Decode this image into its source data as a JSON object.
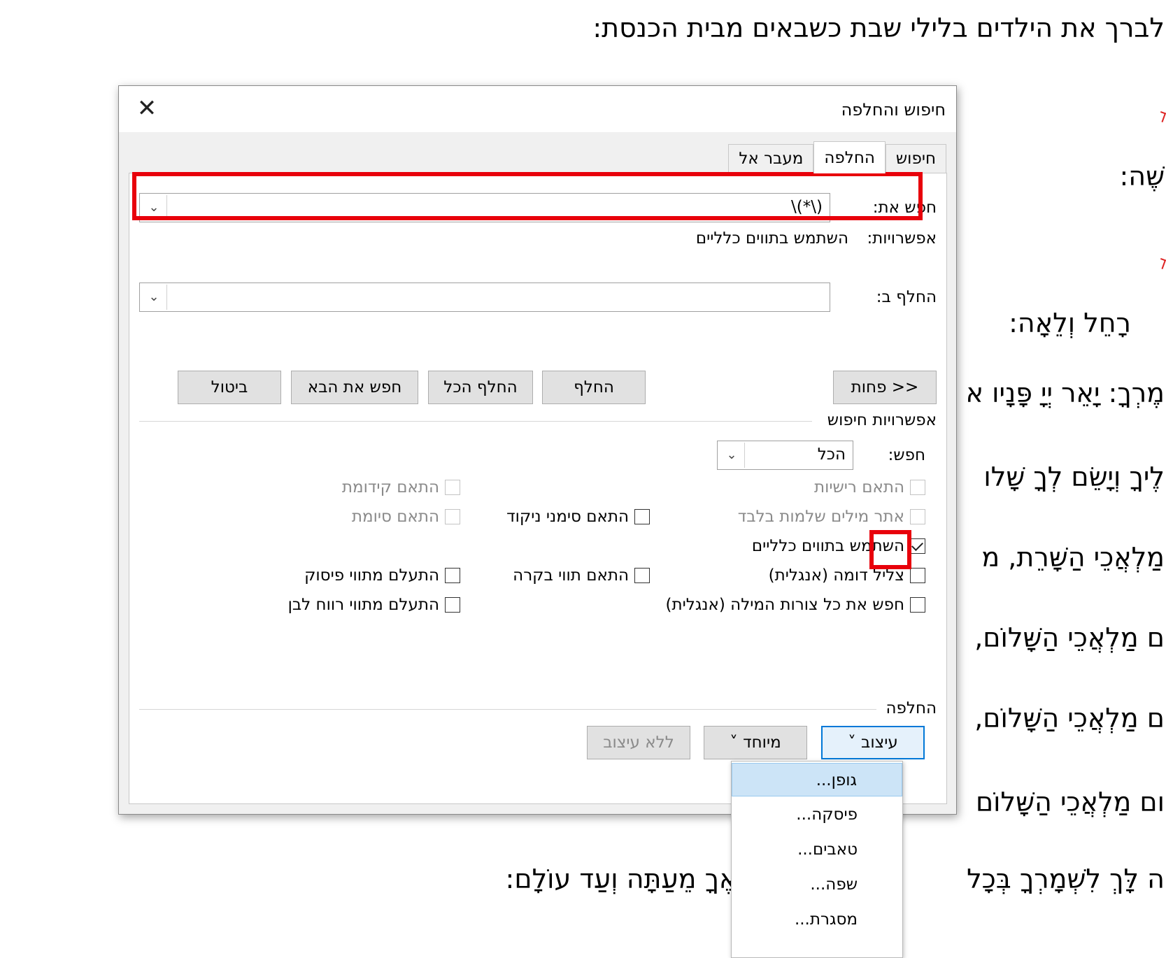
{
  "document": {
    "lines": [
      "לברך את הילדים בלילי שבת כשבאים מבית הכנסת:",
      "ְשֶׁה:",
      "רָחֵל וְלֵאָה:",
      "ְמֶרְךָ: יָאֵר יְיָ פָּנָיו א",
      "ֵלֶיךָ וְיָשֵׂם לְךָ שָׁלו",
      "מַלְאֲכֵי הַשָּׁרֵת, מ",
      "ם מַלְאֲכֵי הַשָּׁלוֹם,",
      "ם מַלְאֲכֵי הַשָּׁלוֹם,",
      "ום מַלְאֲכֵי הַשָּׁלוֹם",
      "ֶה לָּךְ לִשְׁמָרְךָ בְּכָל",
      "ר צֵאתְךָ וּבוֹאֶךָ מֵעַתָּה וְעַד עוֹלָם:"
    ],
    "squiggle_word": "יָאֵר"
  },
  "dialog": {
    "title": "חיפוש והחלפה",
    "close_glyph": "✕",
    "tabs": [
      {
        "label": "חיפוש",
        "underline_char": "י"
      },
      {
        "label": "החלפה",
        "underline_char": "ה"
      },
      {
        "label": "מעבר אל",
        "underline_char": "ע"
      }
    ],
    "find_label": "חפש את:",
    "find_value": "\\(*\\)",
    "options_label": "אפשרויות:",
    "options_value": "השתמש בתווים כלליים",
    "replace_label": "החלף ב:",
    "replace_value": "",
    "dropdown_glyph": "⌄",
    "buttons": {
      "less": "<< פחות",
      "replace": "החלף",
      "replace_all": "החלף הכל",
      "find_next": "חפש את הבא",
      "cancel": "ביטול"
    },
    "search_options_header": "אפשרויות חיפוש",
    "search_label": "חפש:",
    "search_value": "הכל",
    "checkboxes": {
      "match_case": {
        "label": "התאם רישיות",
        "checked": false,
        "enabled": false
      },
      "whole_words": {
        "label": "אתר מילים שלמות בלבד",
        "checked": false,
        "enabled": false
      },
      "wildcards": {
        "label": "השתמש בתווים כלליים",
        "checked": true,
        "enabled": true
      },
      "sounds_like": {
        "label": "צליל דומה (אנגלית)",
        "checked": false,
        "enabled": true
      },
      "word_forms": {
        "label": "חפש את כל צורות המילה (אנגלית)",
        "checked": false,
        "enabled": true
      },
      "diacritics": {
        "label": "התאם סימני ניקוד",
        "checked": false,
        "enabled": true
      },
      "kashida": {
        "label": "התאם תווי בקרה",
        "checked": false,
        "enabled": true
      },
      "prefix": {
        "label": "התאם קידומת",
        "checked": false,
        "enabled": false
      },
      "suffix": {
        "label": "התאם סיומת",
        "checked": false,
        "enabled": false
      },
      "ignore_punct": {
        "label": "התעלם מתווי פיסוק",
        "checked": false,
        "enabled": true
      },
      "ignore_space": {
        "label": "התעלם מתווי רווח לבן",
        "checked": false,
        "enabled": true
      }
    },
    "replace_section_header": "החלפה",
    "format_button": "עיצוב ˅",
    "special_button": "מיוחד ˅",
    "no_formatting_button": "ללא עיצוב"
  },
  "format_menu": {
    "items": [
      "גופן...",
      "פיסקה...",
      "טאבים...",
      "שפה...",
      "מסגרת..."
    ]
  },
  "colors": {
    "highlight_red": "#e8000b",
    "focus_blue": "#0078d7",
    "menu_hover": "#cce4f7"
  }
}
